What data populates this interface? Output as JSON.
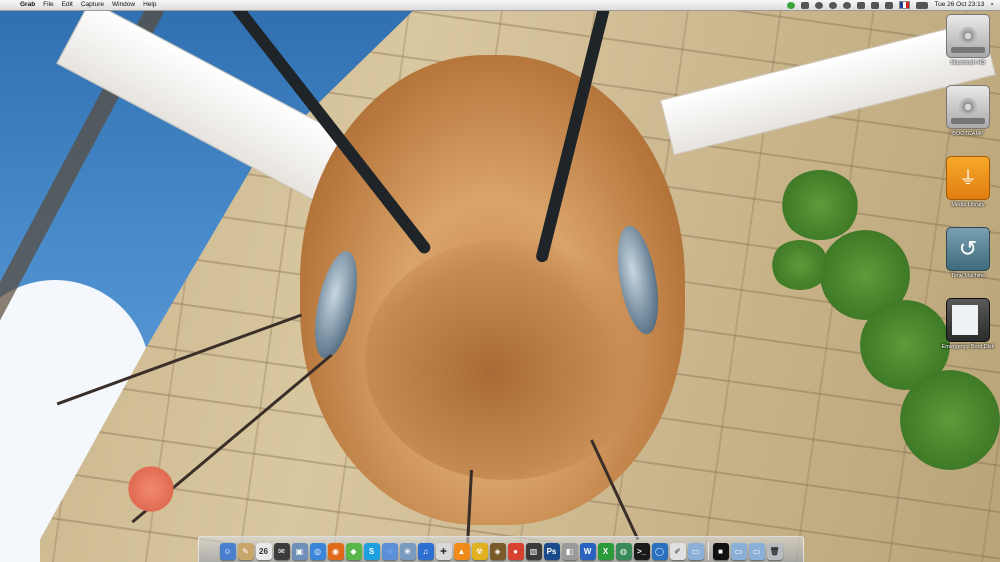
{
  "menubar": {
    "apple_symbol": "",
    "app_name": "Grab",
    "menus": [
      "File",
      "Edit",
      "Capture",
      "Window",
      "Help"
    ],
    "status_icons": [
      "evernote-icon",
      "script-icon",
      "sync-icon",
      "growl-icon",
      "time-machine-icon",
      "bluetooth-icon",
      "wifi-icon",
      "volume-icon",
      "flag-icon",
      "battery-icon"
    ],
    "clock": "Tue 26 Oct  23:13",
    "spotlight_symbol": "⌕"
  },
  "desktop_icons": [
    {
      "name": "Macintosh HD",
      "icon": "hard-drive-icon"
    },
    {
      "name": "BOOTCAMP",
      "icon": "hard-drive-icon"
    },
    {
      "name": "Media Library",
      "icon": "usb-drive-icon"
    },
    {
      "name": "Time Machine",
      "icon": "time-machine-icon"
    },
    {
      "name": "Emergency Boot Disk",
      "icon": "disk-image-icon"
    }
  ],
  "dock": {
    "items": [
      {
        "icon": "finder-icon",
        "color": "#4a7fd0",
        "glyph": "☺"
      },
      {
        "icon": "notes-icon",
        "color": "#c9a66b",
        "glyph": "✎"
      },
      {
        "icon": "ical-icon",
        "color": "#e8e8e8",
        "glyph": "26"
      },
      {
        "icon": "mail-stamp-icon",
        "color": "#3c3c3c",
        "glyph": "✉"
      },
      {
        "icon": "preview-icon",
        "color": "#6f8fb8",
        "glyph": "▣"
      },
      {
        "icon": "safari-icon",
        "color": "#3b86d8",
        "glyph": "◎"
      },
      {
        "icon": "firefox-icon",
        "color": "#e06a1a",
        "glyph": "◉"
      },
      {
        "icon": "adium-icon",
        "color": "#5ab84a",
        "glyph": "◆"
      },
      {
        "icon": "skype-icon",
        "color": "#1fa0e0",
        "glyph": "S"
      },
      {
        "icon": "ichat-icon",
        "color": "#5b8fd8",
        "glyph": "◌"
      },
      {
        "icon": "iphoto-icon",
        "color": "#7a9bc0",
        "glyph": "❀"
      },
      {
        "icon": "itunes-icon",
        "color": "#2d6fd0",
        "glyph": "♫"
      },
      {
        "icon": "utility-icon",
        "color": "#d8d8d8",
        "glyph": "✚"
      },
      {
        "icon": "vlc-icon",
        "color": "#f08a1a",
        "glyph": "▲"
      },
      {
        "icon": "warning-icon",
        "color": "#e0b020",
        "glyph": "☢"
      },
      {
        "icon": "app-icon",
        "color": "#7a5a2a",
        "glyph": "◈"
      },
      {
        "icon": "chrome-icon",
        "color": "#d84030",
        "glyph": "●"
      },
      {
        "icon": "photo-app-icon",
        "color": "#3a3a3a",
        "glyph": "▧"
      },
      {
        "icon": "photoshop-icon",
        "color": "#1a4a8a",
        "glyph": "Ps"
      },
      {
        "icon": "grab-icon",
        "color": "#9a9a9a",
        "glyph": "◧"
      },
      {
        "icon": "word-icon",
        "color": "#2a62c0",
        "glyph": "W"
      },
      {
        "icon": "excel-icon",
        "color": "#2a9a3a",
        "glyph": "X"
      },
      {
        "icon": "activity-monitor-icon",
        "color": "#3a8a5a",
        "glyph": "◍"
      },
      {
        "icon": "terminal-icon",
        "color": "#1a1a1a",
        "glyph": ">_"
      },
      {
        "icon": "app-store-icon",
        "color": "#2a70c0",
        "glyph": "◯"
      },
      {
        "icon": "textedit-icon",
        "color": "#e0e0e0",
        "glyph": "✐"
      },
      {
        "icon": "applications-folder-icon",
        "color": "#8ab0d8",
        "glyph": "▭"
      },
      {
        "icon": "black-app-icon",
        "color": "#111111",
        "glyph": "■"
      },
      {
        "icon": "documents-folder-icon",
        "color": "#8ab0d8",
        "glyph": "▭"
      },
      {
        "icon": "downloads-folder-icon",
        "color": "#8ab0d8",
        "glyph": "▭"
      },
      {
        "icon": "trash-icon",
        "color": "#b8bcc2",
        "glyph": "🗑"
      }
    ],
    "separator_after_index": 26
  }
}
